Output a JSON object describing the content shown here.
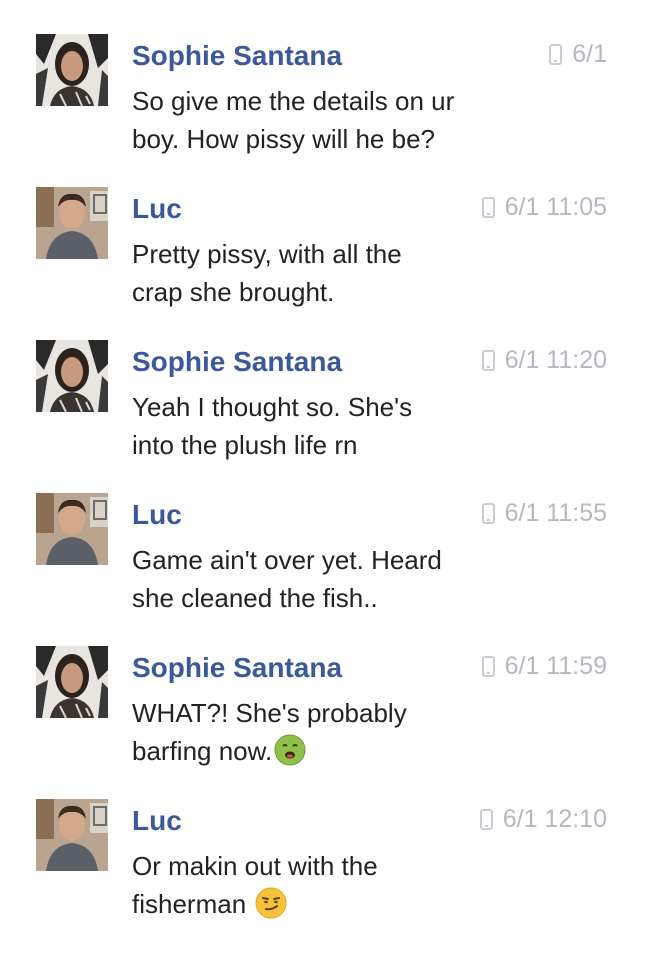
{
  "messages": [
    {
      "sender": "Sophie Santana",
      "avatar": "sophie-avatar",
      "device_icon": "phone-icon",
      "timestamp": "6/1",
      "lines": [
        "So give me the details on ur",
        "boy. How pissy will he be?"
      ]
    },
    {
      "sender": "Luc",
      "avatar": "luc-avatar",
      "device_icon": "phone-icon",
      "timestamp": "6/1 11:05",
      "lines": [
        "Pretty pissy, with all the",
        "crap she brought."
      ]
    },
    {
      "sender": "Sophie Santana",
      "avatar": "sophie-avatar",
      "device_icon": "phone-icon",
      "timestamp": "6/1 11:20",
      "lines": [
        "Yeah I thought so. She's",
        "into the plush life rn"
      ]
    },
    {
      "sender": "Luc",
      "avatar": "luc-avatar",
      "device_icon": "phone-icon",
      "timestamp": "6/1 11:55",
      "lines": [
        "Game ain't over yet. Heard",
        "she cleaned the fish.."
      ]
    },
    {
      "sender": "Sophie Santana",
      "avatar": "sophie-avatar",
      "device_icon": "phone-icon",
      "timestamp": "6/1 11:59",
      "lines": [
        "WHAT?! She's probably",
        "barfing now."
      ],
      "emoji": "nauseated-face-emoji"
    },
    {
      "sender": "Luc",
      "avatar": "luc-avatar",
      "device_icon": "phone-icon",
      "timestamp": "6/1 12:10",
      "lines": [
        "Or makin out with the",
        "fisherman "
      ],
      "emoji": "smirking-face-emoji"
    }
  ],
  "colors": {
    "sender_name": "#3b5998",
    "message_text": "#222222",
    "timestamp": "#b4b8c0"
  }
}
